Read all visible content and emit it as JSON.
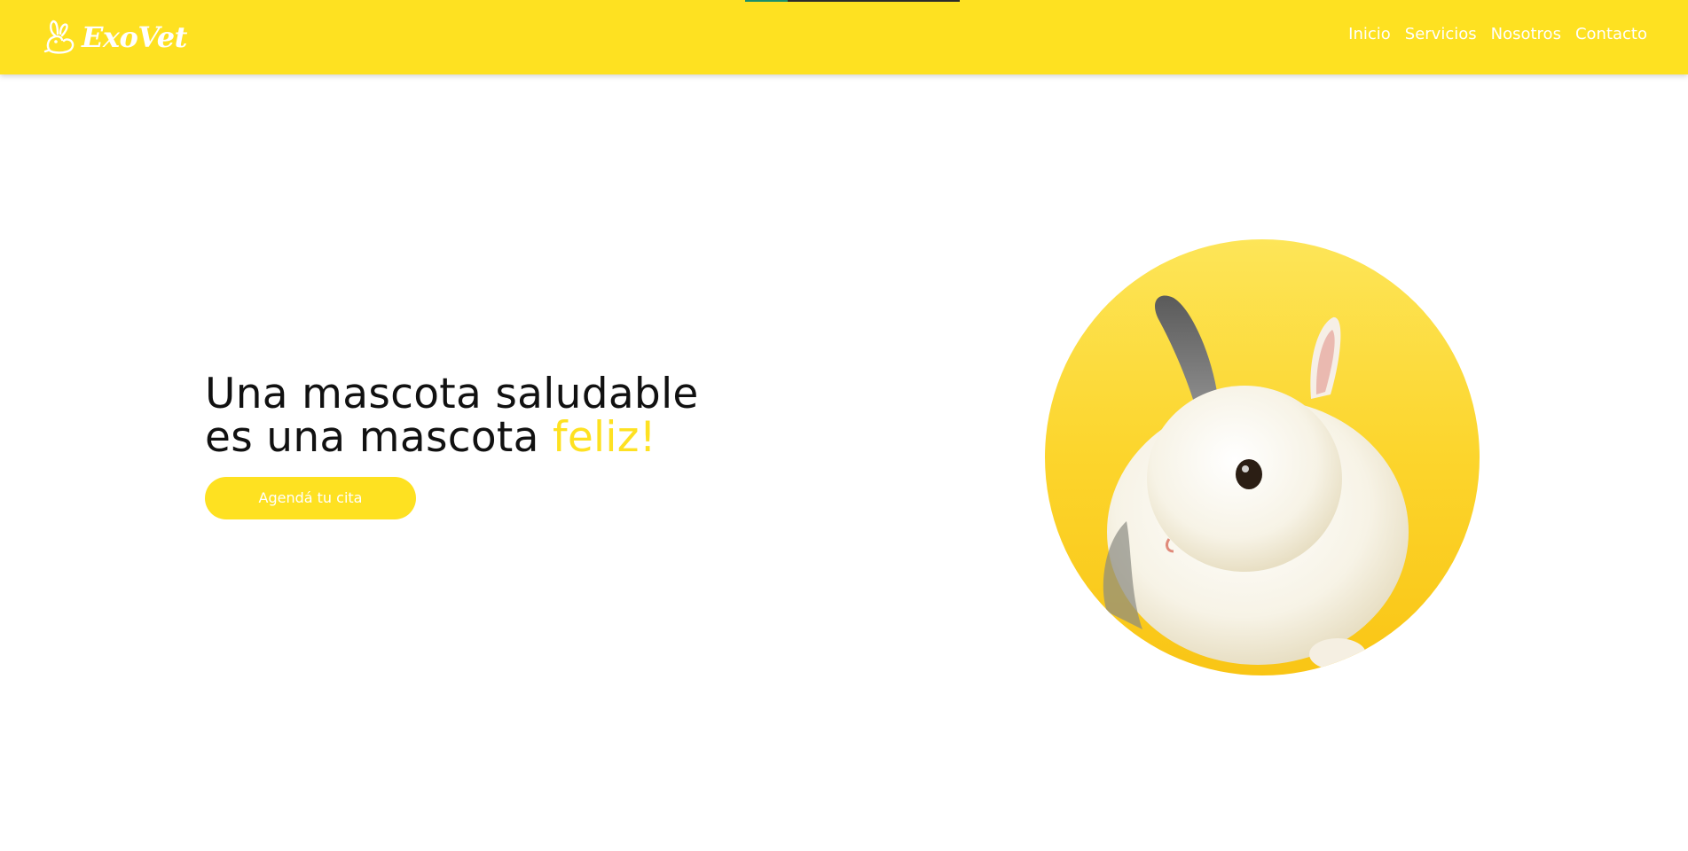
{
  "header": {
    "brand_name": "ExoVet",
    "logo_icon": "rabbit-icon",
    "nav": [
      {
        "label": "Inicio"
      },
      {
        "label": "Servicios"
      },
      {
        "label": "Nosotros"
      },
      {
        "label": "Contacto"
      }
    ]
  },
  "hero": {
    "headline_line1": "Una mascota saludable",
    "headline_line2_start": "es una mascota ",
    "headline_accent": "feliz!",
    "cta_label": "Agendá tu cita",
    "image_subject": "white-rabbit-photo"
  },
  "colors": {
    "brand_yellow": "#fee121",
    "text_dark": "#111111",
    "white": "#ffffff"
  }
}
